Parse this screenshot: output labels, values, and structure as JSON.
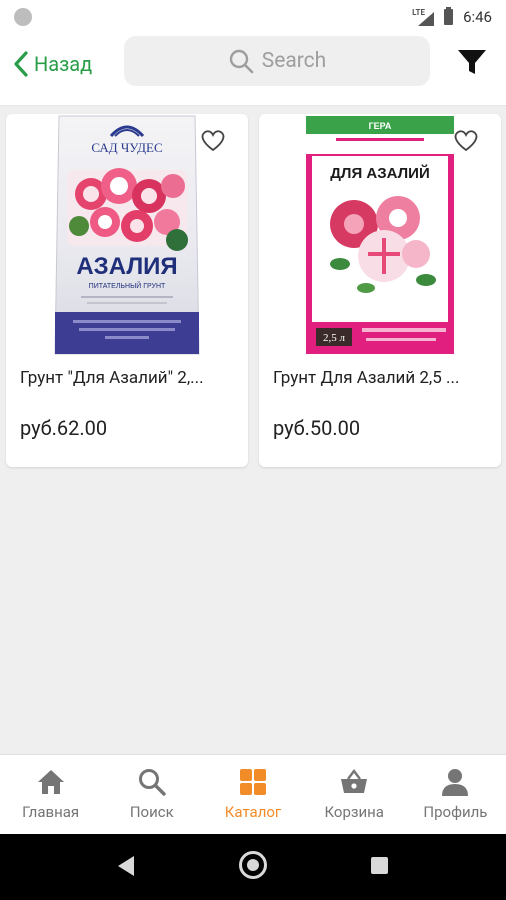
{
  "status_bar": {
    "network": "LTE",
    "time": "6:46"
  },
  "header": {
    "back_label": "Назад",
    "search_placeholder": "Search"
  },
  "products": [
    {
      "title": "Грунт \"Для Азалий\" 2,...",
      "price": "руб.62.00",
      "image_text_brand": "САД ЧУДЕС",
      "image_text_name": "АЗАЛИЯ",
      "image_text_sub": "ПИТАТЕЛЬНЫЙ ГРУНТ"
    },
    {
      "title": "Грунт Для Азалий 2,5 ...",
      "price": "руб.50.00",
      "image_text_brand": "ГЕРА",
      "image_text_name": "ДЛЯ АЗАЛИЙ",
      "image_text_volume": "2,5 л"
    }
  ],
  "bottom_nav": {
    "items": [
      {
        "label": "Главная",
        "icon": "home-icon"
      },
      {
        "label": "Поиск",
        "icon": "search-icon"
      },
      {
        "label": "Каталог",
        "icon": "catalog-icon"
      },
      {
        "label": "Корзина",
        "icon": "basket-icon"
      },
      {
        "label": "Профиль",
        "icon": "profile-icon"
      }
    ],
    "active_index": 2
  },
  "colors": {
    "accent_green": "#2a9d49",
    "accent_orange": "#f28c28"
  }
}
